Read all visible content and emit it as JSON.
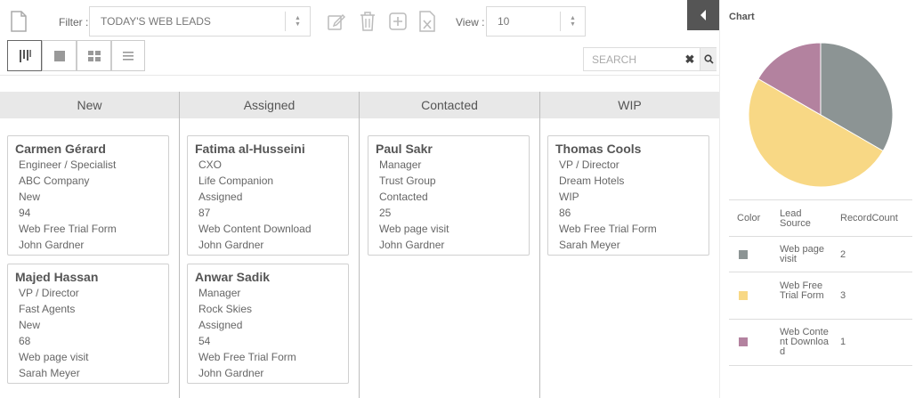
{
  "toolbar": {
    "filter_label": "Filter :",
    "filter_value": "TODAY'S WEB LEADS",
    "view_label": "View :",
    "view_value": "10",
    "icons": [
      "new-document-icon",
      "edit-icon",
      "delete-icon",
      "add-icon",
      "export-excel-icon"
    ],
    "view_modes": [
      "kanban-view",
      "single-view",
      "grid-view",
      "list-view"
    ],
    "active_view_mode": "kanban-view"
  },
  "search": {
    "placeholder": "SEARCH",
    "value": ""
  },
  "columns": [
    {
      "title": "New",
      "cards": [
        {
          "name": "Carmen Gérard",
          "lines": [
            "Engineer / Specialist",
            "ABC Company",
            "New",
            "94",
            "Web Free Trial Form",
            "John Gardner"
          ]
        },
        {
          "name": "Majed Hassan",
          "lines": [
            "VP / Director",
            "Fast Agents",
            "New",
            "68",
            "Web page visit",
            "Sarah Meyer"
          ]
        }
      ]
    },
    {
      "title": "Assigned",
      "cards": [
        {
          "name": "Fatima al-Husseini",
          "lines": [
            "CXO",
            "Life Companion",
            "Assigned",
            "87",
            "Web Content Download",
            "John Gardner"
          ]
        },
        {
          "name": "Anwar Sadik",
          "lines": [
            "Manager",
            "Rock Skies",
            "Assigned",
            "54",
            "Web Free Trial Form",
            "John Gardner"
          ]
        }
      ]
    },
    {
      "title": "Contacted",
      "cards": [
        {
          "name": "Paul Sakr",
          "lines": [
            "Manager",
            "Trust Group",
            "Contacted",
            "25",
            "Web page visit",
            "John Gardner"
          ]
        }
      ]
    },
    {
      "title": "WIP",
      "cards": [
        {
          "name": "Thomas Cools",
          "lines": [
            "VP / Director",
            "Dream Hotels",
            "WIP",
            "86",
            "Web Free Trial Form",
            "Sarah Meyer"
          ]
        }
      ]
    }
  ],
  "chart_panel": {
    "title": "Chart",
    "legend_headers": {
      "color": "Color",
      "source": "Lead Source",
      "count": "RecordCount"
    }
  },
  "chart_data": {
    "type": "pie",
    "title": "Chart",
    "categories": [
      "Web page visit",
      "Web Free Trial Form",
      "Web Content Download"
    ],
    "values": [
      2,
      3,
      1
    ],
    "colors": [
      "#8c9494",
      "#f8d885",
      "#b3829f"
    ]
  }
}
